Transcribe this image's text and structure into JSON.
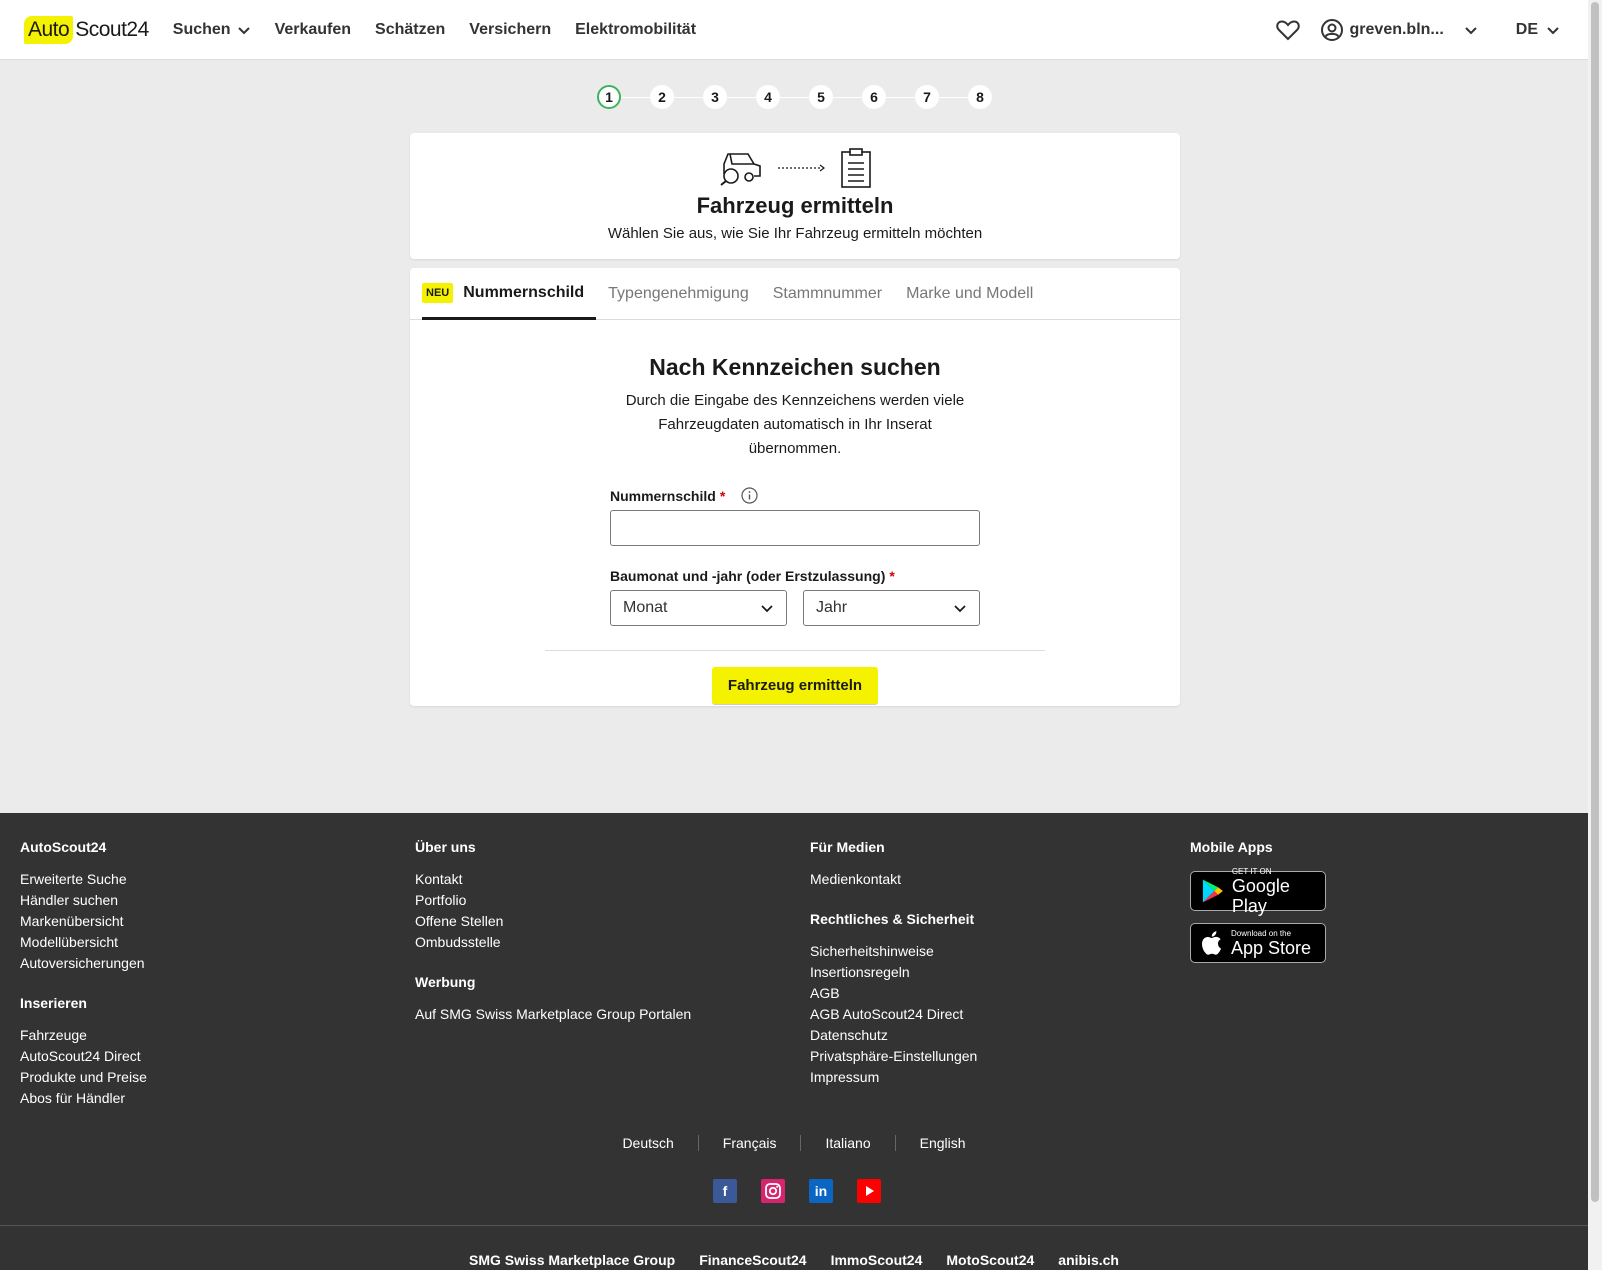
{
  "header": {
    "logo_auto": "Auto",
    "logo_scout": "Scout24",
    "nav": [
      "Suchen",
      "Verkaufen",
      "Schätzen",
      "Versichern",
      "Elektromobilität"
    ],
    "user": "greven.bln...",
    "lang": "DE"
  },
  "stepper": {
    "steps": [
      "1",
      "2",
      "3",
      "4",
      "5",
      "6",
      "7",
      "8"
    ],
    "current": 1
  },
  "intro": {
    "title": "Fahrzeug ermitteln",
    "subtitle": "Wählen Sie aus, wie Sie Ihr Fahrzeug ermitteln möchten"
  },
  "tabs": {
    "badge": "NEU",
    "items": [
      "Nummernschild",
      "Typengenehmigung",
      "Stammnummer",
      "Marke und Modell"
    ],
    "active": 0
  },
  "form": {
    "title": "Nach Kennzeichen suchen",
    "description": "Durch die Eingabe des Kennzeichens werden viele Fahrzeugdaten automatisch in Ihr Inserat übernommen.",
    "plate_label": "Nummernschild",
    "plate_value": "",
    "date_label": "Baumonat und -jahr (oder Erstzulassung)",
    "required_mark": "*",
    "month_select": "Monat",
    "year_select": "Jahr",
    "submit_label": "Fahrzeug ermitteln"
  },
  "footer": {
    "col1": {
      "heading": "AutoScout24",
      "links": [
        "Erweiterte Suche",
        "Händler suchen",
        "Markenübersicht",
        "Modellübersicht",
        "Autoversicherungen"
      ],
      "heading2": "Inserieren",
      "links2": [
        "Fahrzeuge",
        "AutoScout24 Direct",
        "Produkte und Preise",
        "Abos für Händler"
      ]
    },
    "col2": {
      "heading": "Über uns",
      "links": [
        "Kontakt",
        "Portfolio",
        "Offene Stellen",
        "Ombudsstelle"
      ],
      "heading2": "Werbung",
      "links2": [
        "Auf SMG Swiss Marketplace Group Portalen"
      ]
    },
    "col3": {
      "heading": "Für Medien",
      "links": [
        "Medienkontakt"
      ],
      "heading2": "Rechtliches & Sicherheit",
      "links2": [
        "Sicherheitshinweise",
        "Insertionsregeln",
        "AGB",
        "AGB AutoScout24 Direct",
        "Datenschutz",
        "Privatsphäre-Einstellungen",
        "Impressum"
      ]
    },
    "col4": {
      "heading": "Mobile Apps",
      "google_small": "GET IT ON",
      "google_big": "Google Play",
      "apple_small": "Download on the",
      "apple_big": "App Store"
    },
    "languages": [
      "Deutsch",
      "Français",
      "Italiano",
      "English"
    ],
    "social_icons": [
      "facebook-icon",
      "instagram-icon",
      "linkedin-icon",
      "youtube-icon"
    ],
    "bottom_links": [
      "SMG Swiss Marketplace Group",
      "FinanceScout24",
      "ImmoScout24",
      "MotoScout24",
      "anibis.ch"
    ]
  },
  "colors": {
    "brand_yellow": "#f5f200",
    "footer_bg": "#333333",
    "step_active": "#3bb55b",
    "page_bg": "#ebebeb"
  }
}
